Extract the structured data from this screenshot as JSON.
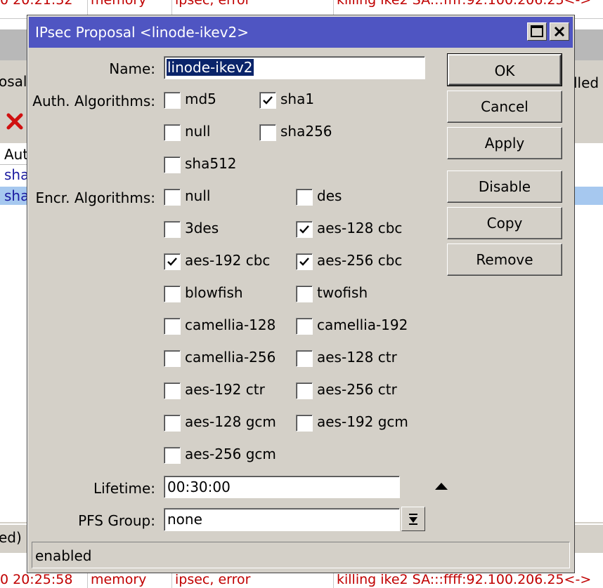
{
  "background": {
    "top_row": {
      "time": "0 20:21:32",
      "topics": "memory",
      "type": "ipsec, error",
      "message": "killing ike2 SA:::ffff:92.100.206.25<->"
    },
    "bottom_row": {
      "time": "0 20:25:58",
      "topics": "memory",
      "type": "ipsec, error",
      "message": "killing ike2 SA:::ffff:92.100.206.25<->"
    },
    "left_tab": "osals",
    "left_col_header": "Aut",
    "left_rows": [
      "sha",
      "sha"
    ],
    "left_status": "ed)",
    "right_fragment": "lled",
    "remove_icon": "red-x-icon"
  },
  "dialog": {
    "title": "IPsec Proposal <linode-ikev2>",
    "name_label": "Name:",
    "name_value": "linode-ikev2",
    "auth_label": "Auth. Algorithms:",
    "auth_algorithms": [
      {
        "label": "md5",
        "checked": false
      },
      {
        "label": "sha1",
        "checked": true
      },
      {
        "label": "null",
        "checked": false
      },
      {
        "label": "sha256",
        "checked": false
      },
      {
        "label": "sha512",
        "checked": false
      }
    ],
    "encr_label": "Encr. Algorithms:",
    "encr_algorithms": [
      {
        "label": "null",
        "checked": false
      },
      {
        "label": "des",
        "checked": false
      },
      {
        "label": "3des",
        "checked": false
      },
      {
        "label": "aes-128 cbc",
        "checked": true
      },
      {
        "label": "aes-192 cbc",
        "checked": true
      },
      {
        "label": "aes-256 cbc",
        "checked": true
      },
      {
        "label": "blowfish",
        "checked": false
      },
      {
        "label": "twofish",
        "checked": false
      },
      {
        "label": "camellia-128",
        "checked": false
      },
      {
        "label": "camellia-192",
        "checked": false
      },
      {
        "label": "camellia-256",
        "checked": false
      },
      {
        "label": "aes-128 ctr",
        "checked": false
      },
      {
        "label": "aes-192 ctr",
        "checked": false
      },
      {
        "label": "aes-256 ctr",
        "checked": false
      },
      {
        "label": "aes-128 gcm",
        "checked": false
      },
      {
        "label": "aes-192 gcm",
        "checked": false
      },
      {
        "label": "aes-256 gcm",
        "checked": false
      }
    ],
    "lifetime_label": "Lifetime:",
    "lifetime_value": "00:30:00",
    "pfs_label": "PFS Group:",
    "pfs_value": "none",
    "buttons": {
      "ok": "OK",
      "cancel": "Cancel",
      "apply": "Apply",
      "disable": "Disable",
      "copy": "Copy",
      "remove": "Remove"
    },
    "status": "enabled"
  },
  "colors": {
    "titlebar": "#4f55c2",
    "dialog_bg": "#d4d0c8",
    "log_error_text": "#c00000",
    "selection": "#0a246a"
  }
}
